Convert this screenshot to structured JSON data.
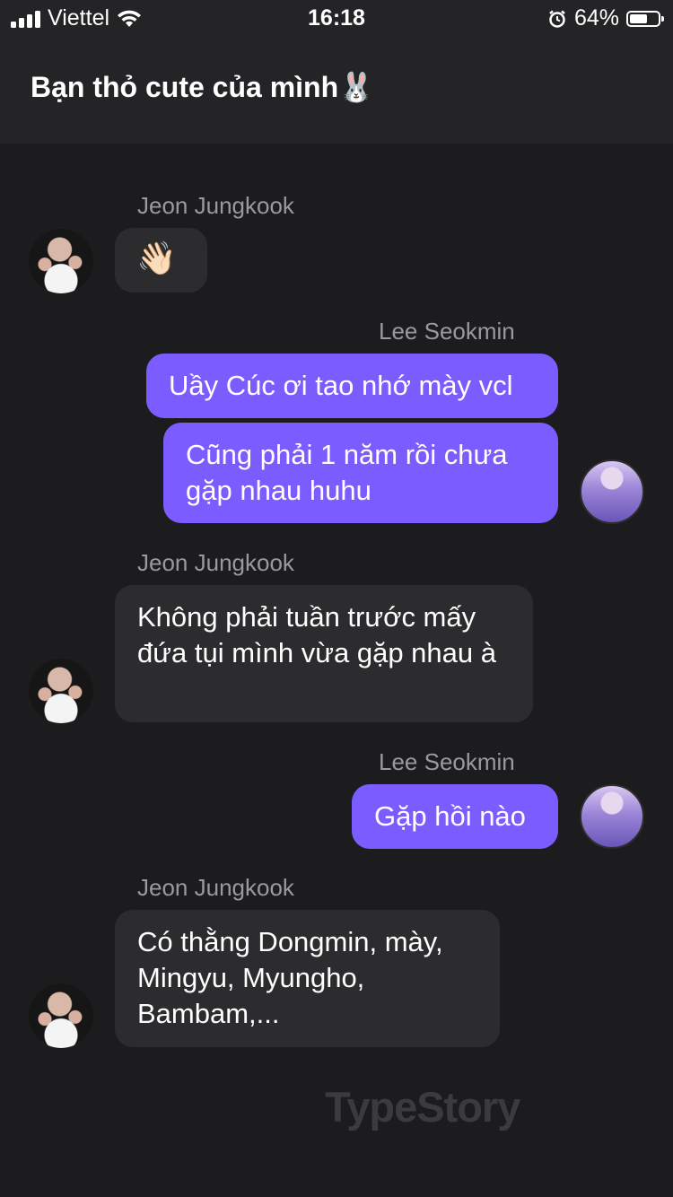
{
  "status_bar": {
    "carrier": "Viettel",
    "time": "16:18",
    "battery": "64%",
    "battery_level_percent": 64
  },
  "header": {
    "title": "Bạn thỏ cute của mình🐰"
  },
  "messages": [
    {
      "sender": "Jeon Jungkook",
      "text": "👋🏻"
    },
    {
      "sender": "Lee Seokmin",
      "text": "Uầy Cúc ơi tao nhớ mày vcl"
    },
    {
      "sender": "Lee Seokmin",
      "text": "Cũng phải 1 năm rồi chưa gặp nhau huhu"
    },
    {
      "sender": "Jeon Jungkook",
      "text": "Không phải tuần trước mấy đứa tụi mình vừa gặp nhau à"
    },
    {
      "sender": "Lee Seokmin",
      "text": "Gặp hồi nào"
    },
    {
      "sender": "Jeon Jungkook",
      "text": "Có thằng Dongmin, mày, Mingyu, Myungho, Bambam,..."
    }
  ],
  "watermark": "TypeStory",
  "colors": {
    "background": "#1c1c1e",
    "header_bg": "#242426",
    "incoming_bubble": "#2c2c2e",
    "outgoing_bubble": "#7a5cff",
    "sender_label": "#9a9a9e"
  },
  "icons": {
    "signal": "cellular-signal-icon",
    "wifi": "wifi-icon",
    "alarm": "alarm-icon",
    "battery": "battery-icon"
  }
}
